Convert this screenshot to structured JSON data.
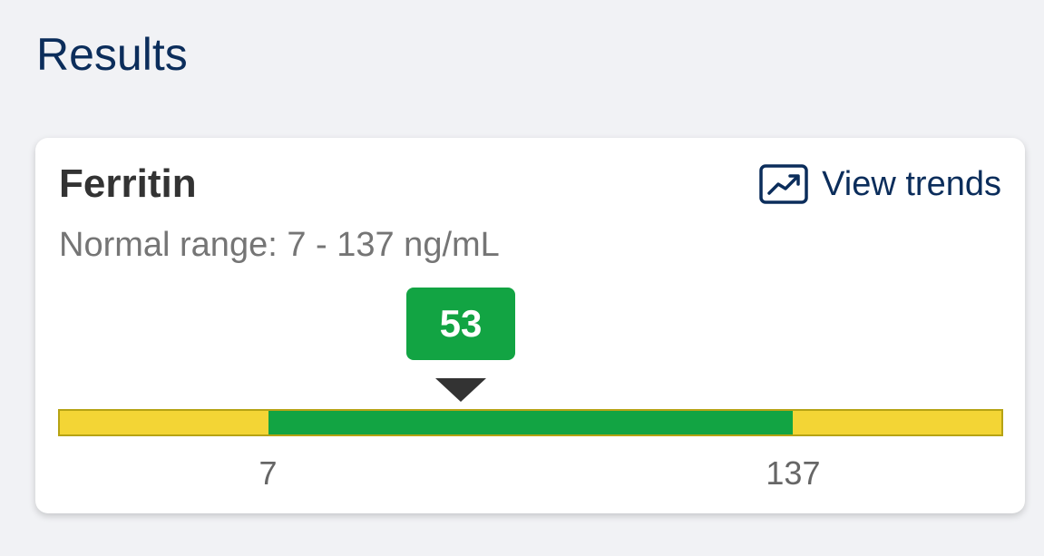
{
  "page": {
    "title": "Results"
  },
  "result_card": {
    "test_name": "Ferritin",
    "view_trends_label": "View trends",
    "view_trends_icon": "trend-chart-icon",
    "normal_range_text": "Normal range: 7 - 137 ng/mL",
    "value": "53",
    "normal_low": 7,
    "normal_high": 137,
    "scale_min": -45,
    "scale_max": 189,
    "tick_labels": {
      "low": "7",
      "high": "137"
    },
    "colors": {
      "normal": "#12a443",
      "out_of_range": "#f3d535",
      "accent_text": "#0b2d5b"
    }
  }
}
